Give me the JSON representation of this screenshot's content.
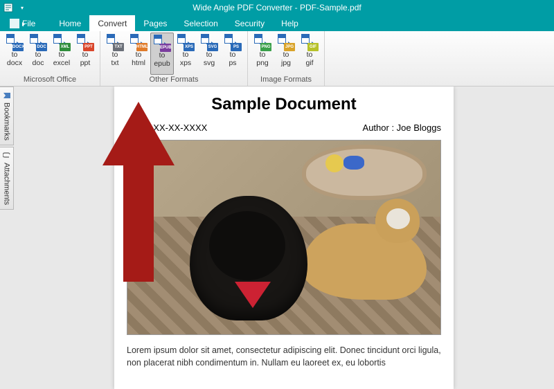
{
  "titleBar": {
    "title": "Wide Angle PDF Converter - PDF-Sample.pdf"
  },
  "menu": {
    "file": "File",
    "items": [
      "Home",
      "Convert",
      "Pages",
      "Selection",
      "Security",
      "Help"
    ],
    "activeIndex": 1
  },
  "ribbon": {
    "groups": [
      {
        "label": "Microsoft Office",
        "buttons": [
          {
            "line1": "to",
            "line2": "docx",
            "badge": "DOCX",
            "color": "#2a6ab8"
          },
          {
            "line1": "to",
            "line2": "doc",
            "badge": "DOC",
            "color": "#2a6ab8"
          },
          {
            "line1": "to",
            "line2": "excel",
            "badge": "XML",
            "color": "#2f8e3c"
          },
          {
            "line1": "to",
            "line2": "ppt",
            "badge": "PPT",
            "color": "#d9452a"
          }
        ]
      },
      {
        "label": "Other Formats",
        "buttons": [
          {
            "line1": "to",
            "line2": "txt",
            "badge": "TXT",
            "color": "#6a6f78"
          },
          {
            "line1": "to",
            "line2": "html",
            "badge": "HTML",
            "color": "#e07b2a"
          },
          {
            "line1": "to",
            "line2": "epub",
            "badge": "EPUB",
            "color": "#7a3c9e",
            "highlight": true
          },
          {
            "line1": "to",
            "line2": "xps",
            "badge": "XPS",
            "color": "#2a6ab8"
          },
          {
            "line1": "to",
            "line2": "svg",
            "badge": "SVG",
            "color": "#2a6ab8"
          },
          {
            "line1": "to",
            "line2": "ps",
            "badge": "PS",
            "color": "#2a6ab8"
          }
        ]
      },
      {
        "label": "Image Formats",
        "buttons": [
          {
            "line1": "to",
            "line2": "png",
            "badge": "PNG",
            "color": "#3aa04a"
          },
          {
            "line1": "to",
            "line2": "jpg",
            "badge": "JPG",
            "color": "#d9a32a"
          },
          {
            "line1": "to",
            "line2": "gif",
            "badge": "GIF",
            "color": "#b7c22a"
          }
        ]
      }
    ]
  },
  "sideTabs": {
    "bookmarks": "Bookmarks",
    "attachments": "Attachments"
  },
  "document": {
    "title": "Sample Document",
    "dateLabel": "Date : XX-XX-XXXX",
    "authorLabel": "Author : Joe Bloggs",
    "body": "Lorem ipsum dolor sit amet, consectetur adipiscing elit. Donec tincidunt orci ligula, non placerat nibh condimentum in. Nullam eu laoreet ex, eu lobortis"
  }
}
